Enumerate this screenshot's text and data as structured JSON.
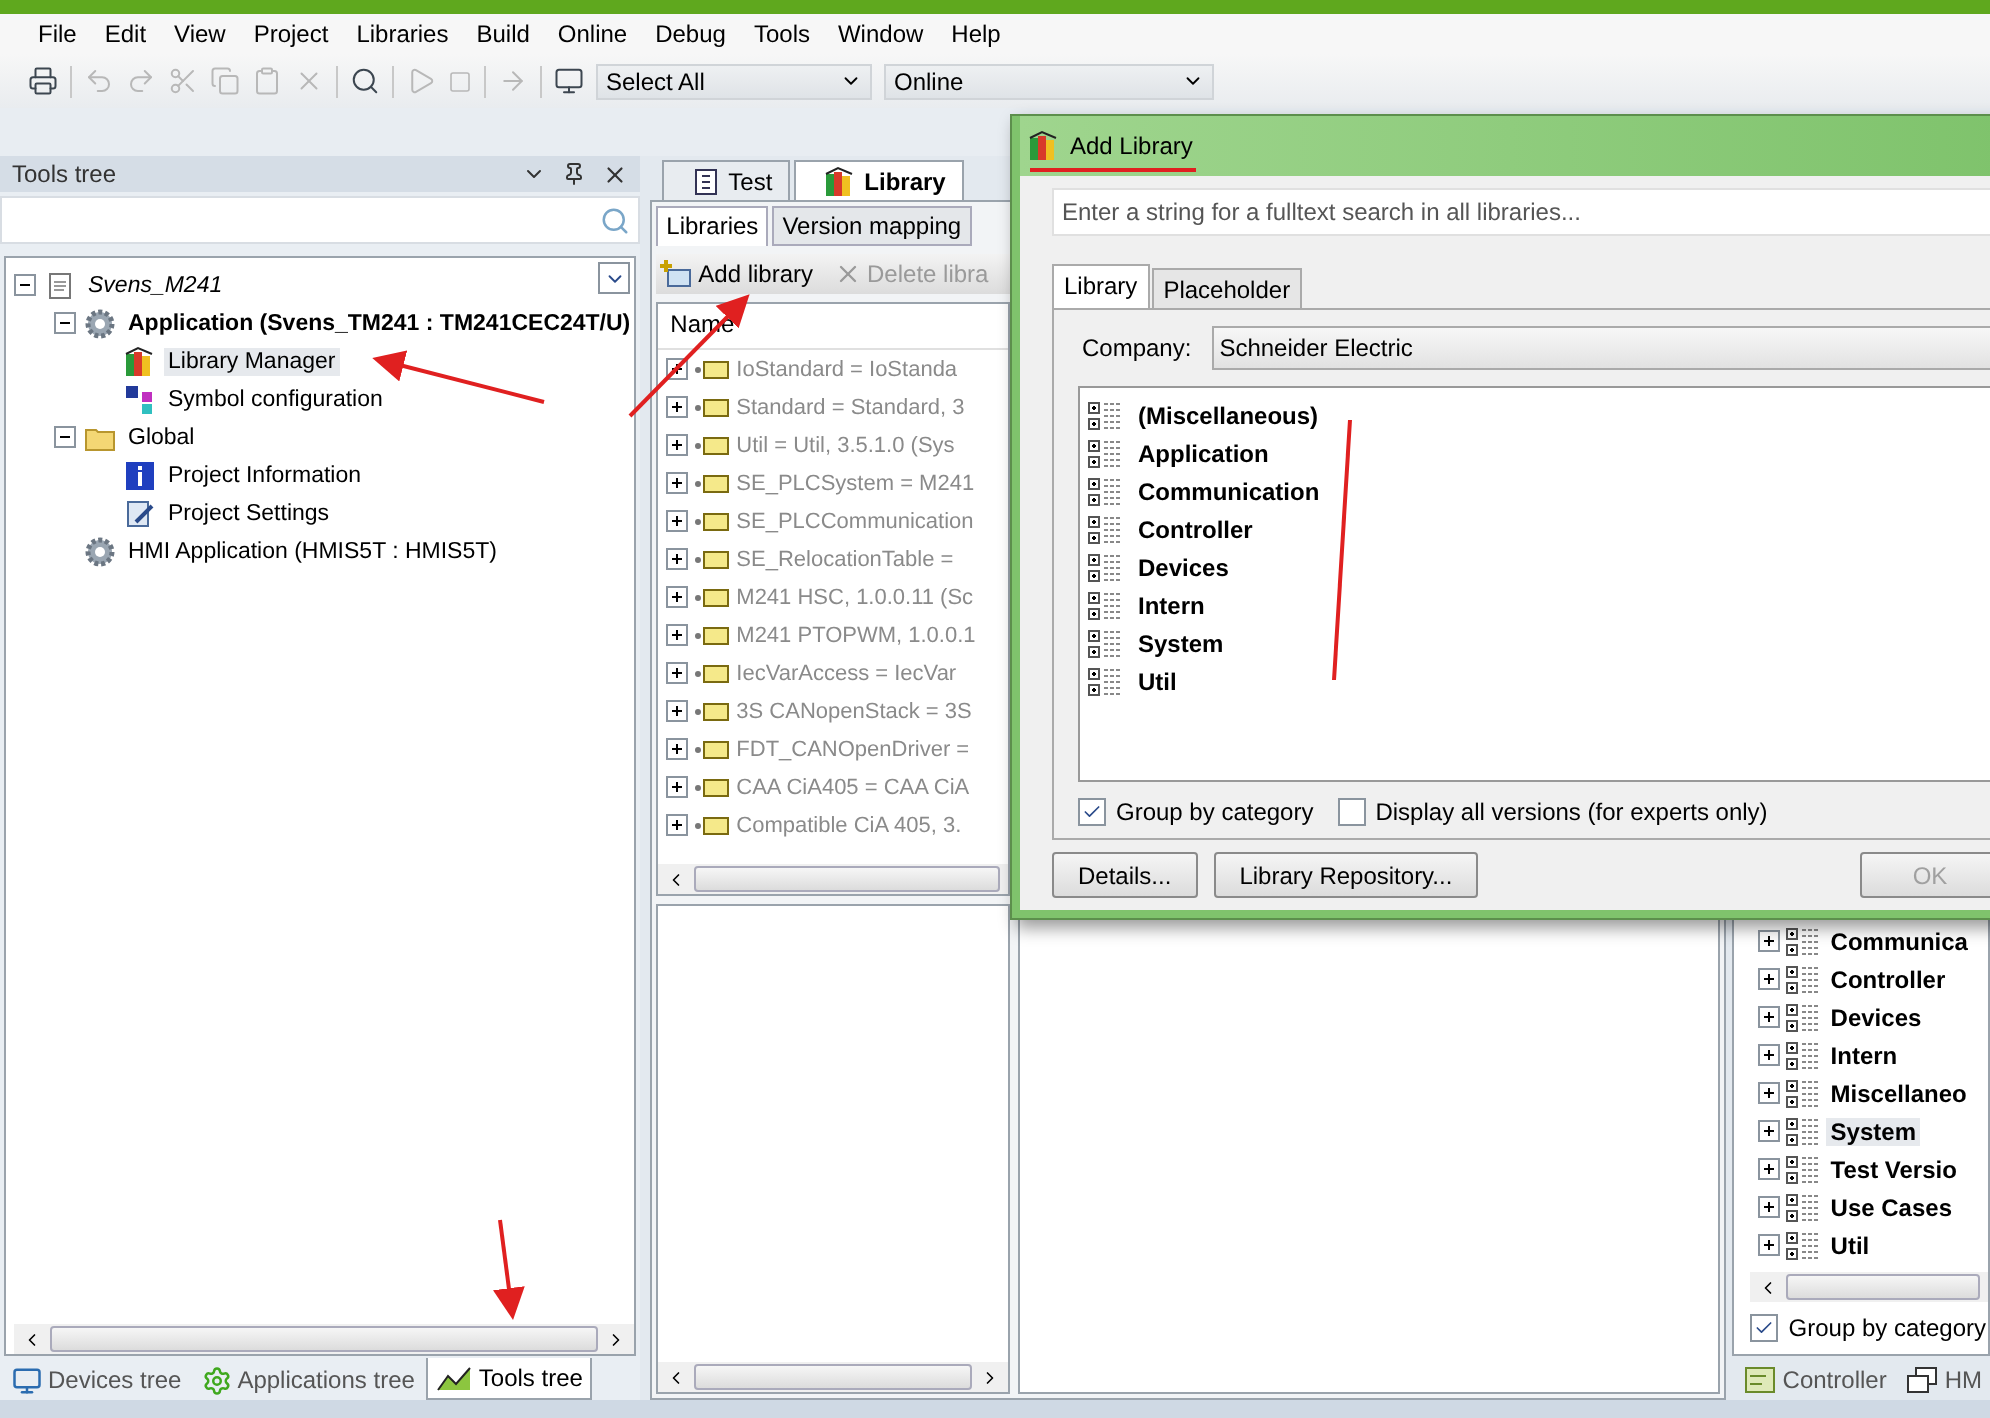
{
  "menu": [
    "File",
    "Edit",
    "View",
    "Project",
    "Libraries",
    "Build",
    "Online",
    "Debug",
    "Tools",
    "Window",
    "Help"
  ],
  "toolbar": {
    "selection": "Select All",
    "mode": "Online"
  },
  "tools_panel": {
    "title": "Tools tree",
    "tree": [
      {
        "label": "Svens_M241",
        "kind": "project",
        "expanded": true,
        "children": [
          {
            "label": "Application (Svens_TM241 : TM241CEC24T/U)",
            "kind": "application",
            "active": true,
            "expanded": true,
            "children": [
              {
                "label": "Library Manager",
                "kind": "library",
                "selected": true
              },
              {
                "label": "Symbol configuration",
                "kind": "symbols",
                "selected": false
              }
            ]
          },
          {
            "label": "Global",
            "kind": "folder",
            "expanded": true,
            "children": [
              {
                "label": "Project Information",
                "kind": "info",
                "selected": false
              },
              {
                "label": "Project Settings",
                "kind": "settings",
                "selected": false
              }
            ]
          },
          {
            "label": "HMI Application (HMIS5T : HMIS5T)",
            "kind": "application",
            "active": false
          }
        ]
      }
    ],
    "tabs": [
      {
        "label": "Devices tree",
        "kind": "devices",
        "selected": false
      },
      {
        "label": "Applications tree",
        "kind": "applications",
        "selected": false
      },
      {
        "label": "Tools tree",
        "kind": "tools",
        "selected": true
      }
    ]
  },
  "editor": {
    "doc_tabs": [
      {
        "label": "Test",
        "kind": "code",
        "selected": false
      },
      {
        "label": "Library",
        "kind": "library",
        "selected": true
      }
    ],
    "sub_tabs": [
      {
        "label": "Libraries",
        "selected": true
      },
      {
        "label": "Version mapping",
        "selected": false
      }
    ],
    "actions": [
      {
        "label": "Add library",
        "kind": "add",
        "disabled": false
      },
      {
        "label": "Delete libra",
        "kind": "delete",
        "disabled": true
      }
    ],
    "column": "Name",
    "rows": [
      "IoStandard = IoStanda",
      "Standard = Standard, 3",
      "Util = Util, 3.5.1.0 (Sys",
      "SE_PLCSystem = M241",
      "SE_PLCCommunication",
      "SE_RelocationTable =",
      "M241 HSC, 1.0.0.11 (Sc",
      "M241 PTOPWM, 1.0.0.1",
      "IecVarAccess = IecVar",
      "3S CANopenStack = 3S",
      "FDT_CANOpenDriver =",
      "CAA CiA405 = CAA CiA",
      "Compatible CiA 405, 3."
    ]
  },
  "right_panel": {
    "items": [
      {
        "label": "Communica",
        "selected": false
      },
      {
        "label": "Controller",
        "selected": false
      },
      {
        "label": "Devices",
        "selected": false
      },
      {
        "label": "Intern",
        "selected": false
      },
      {
        "label": "Miscellaneo",
        "selected": false
      },
      {
        "label": "System",
        "selected": true
      },
      {
        "label": "Test Versio",
        "selected": false
      },
      {
        "label": "Use Cases",
        "selected": false
      },
      {
        "label": "Util",
        "selected": false
      }
    ],
    "group_by_category": {
      "label": "Group by category",
      "checked": true
    },
    "tabs": [
      {
        "label": "Controller",
        "kind": "controller"
      },
      {
        "label": "HM",
        "kind": "hmi"
      }
    ]
  },
  "dialog": {
    "title": "Add Library",
    "search_placeholder": "Enter a string for a fulltext search in all libraries...",
    "tabs": [
      {
        "label": "Library",
        "selected": true
      },
      {
        "label": "Placeholder",
        "selected": false
      }
    ],
    "company_label": "Company:",
    "company": "Schneider Electric",
    "categories": [
      "(Miscellaneous)",
      "Application",
      "Communication",
      "Controller",
      "Devices",
      "Intern",
      "System",
      "Util"
    ],
    "group_by_category": {
      "label": "Group by category",
      "checked": true
    },
    "display_all_versions": {
      "label": "Display all versions (for experts only)",
      "checked": false
    },
    "buttons": [
      {
        "label": "Details...",
        "disabled": false
      },
      {
        "label": "Library Repository...",
        "disabled": false
      },
      {
        "label": "OK",
        "disabled": true
      }
    ]
  }
}
